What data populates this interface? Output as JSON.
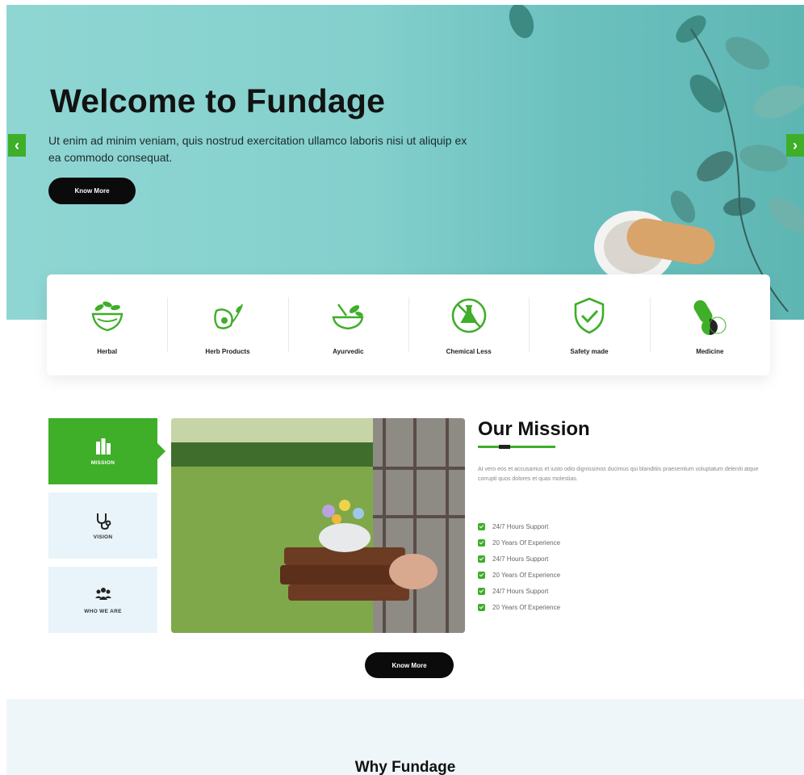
{
  "hero": {
    "title": "Welcome to Fundage",
    "subtitle": "Ut enim ad minim veniam, quis nostrud exercitation ullamco laboris nisi ut aliquip ex ea commodo consequat.",
    "button": "Know More",
    "prev_arrow": "‹",
    "next_arrow": "›"
  },
  "features": [
    {
      "label": "Herbal",
      "icon": "mortar-herbs-icon"
    },
    {
      "label": "Herb Products",
      "icon": "herb-bottle-icon"
    },
    {
      "label": "Ayurvedic",
      "icon": "ayurvedic-bowl-icon"
    },
    {
      "label": "Chemical Less",
      "icon": "no-chemical-flask-icon"
    },
    {
      "label": "Safety made",
      "icon": "shield-check-icon"
    },
    {
      "label": "Medicine",
      "icon": "capsule-icon"
    }
  ],
  "tabs": [
    {
      "label": "MISSION",
      "icon": "building-icon",
      "active": true
    },
    {
      "label": "VISION",
      "icon": "stethoscope-icon",
      "active": false
    },
    {
      "label": "WHO WE ARE",
      "icon": "team-icon",
      "active": false
    }
  ],
  "mission": {
    "title": "Our Mission",
    "text": "At vero eos et accusamus et iusto odio dignissimos ducimus qui blanditiis praesentium voluptatum deleniti atque corrupti quos dolores et quas molestias.",
    "items": [
      "24/7 Hours Support",
      "20 Years Of Experience",
      "24/7 Hours Support",
      "20 Years Of Experience",
      "24/7 Hours Support",
      "20 Years Of Experience"
    ],
    "button": "Know More"
  },
  "why": {
    "title": "Why Fundage"
  },
  "colors": {
    "accent": "#3fae29",
    "hero_bg": "#8fd6d3",
    "dark": "#0b0b0b",
    "light_panel": "#e8f4fa"
  }
}
